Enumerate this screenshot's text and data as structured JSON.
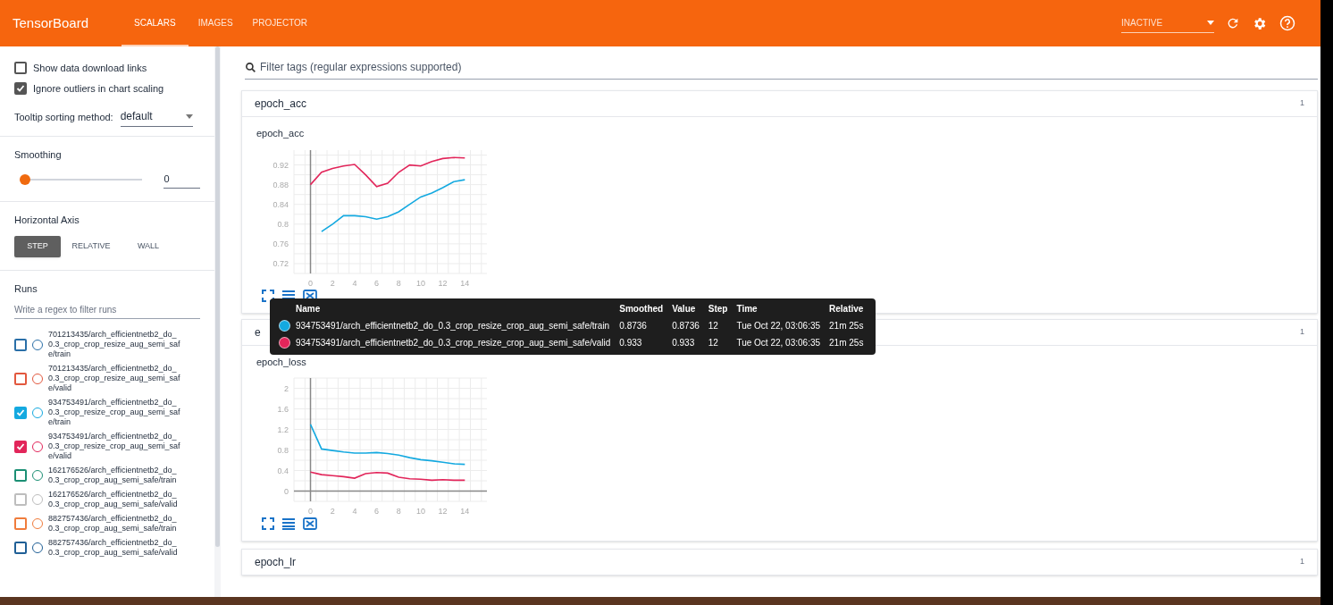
{
  "app": {
    "title": "TensorBoard",
    "tabs": [
      {
        "label": "SCALARS",
        "selected": true
      },
      {
        "label": "IMAGES",
        "selected": false
      },
      {
        "label": "PROJECTOR",
        "selected": false
      }
    ],
    "status": "INACTIVE"
  },
  "sidebar": {
    "options": [
      {
        "label": "Show data download links",
        "checked": false
      },
      {
        "label": "Ignore outliers in chart scaling",
        "checked": true
      }
    ],
    "tooltip_sorting": {
      "label": "Tooltip sorting method:",
      "value": "default"
    },
    "smoothing": {
      "label": "Smoothing",
      "level": 0,
      "value": "0"
    },
    "horizontal_axis": {
      "label": "Horizontal Axis",
      "options": [
        {
          "label": "STEP",
          "selected": true
        },
        {
          "label": "RELATIVE",
          "selected": false
        },
        {
          "label": "WALL",
          "selected": false
        }
      ]
    },
    "runs": {
      "label": "Runs",
      "placeholder": "Write a regex to filter runs",
      "items": [
        {
          "name": "701213435/arch_efficientnetb2_do_0.3_crop_crop_resize_aug_semi_safe/train",
          "checked": false,
          "color": "#2a6fa8"
        },
        {
          "name": "701213435/arch_efficientnetb2_do_0.3_crop_crop_resize_aug_semi_safe/valid",
          "checked": false,
          "color": "#e2583e"
        },
        {
          "name": "934753491/arch_efficientnetb2_do_0.3_crop_resize_crop_aug_semi_safe/train",
          "checked": true,
          "color": "#14a9e0"
        },
        {
          "name": "934753491/arch_efficientnetb2_do_0.3_crop_resize_crop_aug_semi_safe/valid",
          "checked": true,
          "color": "#e2255a"
        },
        {
          "name": "162176526/arch_efficientnetb2_do_0.3_crop_crop_aug_semi_safe/train",
          "checked": false,
          "color": "#1b8f74"
        },
        {
          "name": "162176526/arch_efficientnetb2_do_0.3_crop_crop_aug_semi_safe/valid",
          "checked": false,
          "color": "#bdbdbd"
        },
        {
          "name": "882757436/arch_efficientnetb2_do_0.3_crop_crop_aug_semi_safe/train",
          "checked": false,
          "color": "#f07c3c"
        },
        {
          "name": "882757436/arch_efficientnetb2_do_0.3_crop_crop_aug_semi_safe/valid",
          "checked": false,
          "color": "#1f5f96"
        }
      ]
    }
  },
  "main": {
    "filter": {
      "placeholder": "Filter tags (regular expressions supported)"
    },
    "sections": [
      {
        "title": "epoch_acc",
        "count": "1",
        "charts": [
          {
            "title": "epoch_acc",
            "chart_data": {
              "type": "line",
              "x": [
                0,
                1,
                2,
                3,
                4,
                5,
                6,
                7,
                8,
                9,
                10,
                11,
                12,
                13,
                14
              ],
              "xlim": [
                -1.5,
                16
              ],
              "ylim": [
                0.7,
                0.95
              ],
              "xticks": [
                0,
                2,
                4,
                6,
                8,
                10,
                12,
                14
              ],
              "yticks": [
                0.72,
                0.76,
                0.8,
                0.84,
                0.88,
                0.92
              ],
              "grid": true,
              "series": [
                {
                  "color": "#14a9e0",
                  "values": [
                    null,
                    0.785,
                    0.8,
                    0.817,
                    0.817,
                    0.815,
                    0.81,
                    0.815,
                    0.825,
                    0.84,
                    0.855,
                    0.863,
                    0.874,
                    0.886,
                    0.89
                  ]
                },
                {
                  "color": "#e2255a",
                  "values": [
                    0.88,
                    0.905,
                    0.913,
                    0.918,
                    0.921,
                    0.9,
                    0.876,
                    0.883,
                    0.905,
                    0.92,
                    0.918,
                    0.927,
                    0.933,
                    0.935,
                    0.934
                  ]
                }
              ]
            }
          }
        ]
      },
      {
        "title": "e",
        "count": "1",
        "charts": [
          {
            "title": "epoch_loss",
            "chart_data": {
              "type": "line",
              "x": [
                0,
                1,
                2,
                3,
                4,
                5,
                6,
                7,
                8,
                9,
                10,
                11,
                12,
                13,
                14
              ],
              "xlim": [
                -1.5,
                16
              ],
              "ylim": [
                -0.2,
                2.2
              ],
              "xticks": [
                0,
                2,
                4,
                6,
                8,
                10,
                12,
                14
              ],
              "yticks": [
                0,
                0.4,
                0.8,
                1.2,
                1.6,
                2
              ],
              "grid": true,
              "series": [
                {
                  "color": "#14a9e0",
                  "values": [
                    1.3,
                    0.82,
                    0.79,
                    0.76,
                    0.74,
                    0.74,
                    0.75,
                    0.73,
                    0.7,
                    0.65,
                    0.61,
                    0.59,
                    0.56,
                    0.53,
                    0.52
                  ]
                },
                {
                  "color": "#e2255a",
                  "values": [
                    0.37,
                    0.32,
                    0.3,
                    0.28,
                    0.25,
                    0.34,
                    0.36,
                    0.35,
                    0.27,
                    0.24,
                    0.23,
                    0.21,
                    0.22,
                    0.21,
                    0.21
                  ]
                }
              ]
            }
          }
        ]
      },
      {
        "title": "epoch_lr",
        "count": "1"
      }
    ],
    "tooltip": {
      "columns": [
        "Name",
        "Smoothed",
        "Value",
        "Step",
        "Time",
        "Relative"
      ],
      "rows": [
        {
          "color": "#14a9e0",
          "cells": [
            "934753491/arch_efficientnetb2_do_0.3_crop_resize_crop_aug_semi_safe/train",
            "0.8736",
            "0.8736",
            "12",
            "Tue Oct 22, 03:06:35",
            "21m 25s"
          ]
        },
        {
          "color": "#e2255a",
          "cells": [
            "934753491/arch_efficientnetb2_do_0.3_crop_resize_crop_aug_semi_safe/valid",
            "0.933",
            "0.933",
            "12",
            "Tue Oct 22, 03:06:35",
            "21m 25s"
          ]
        }
      ]
    }
  }
}
